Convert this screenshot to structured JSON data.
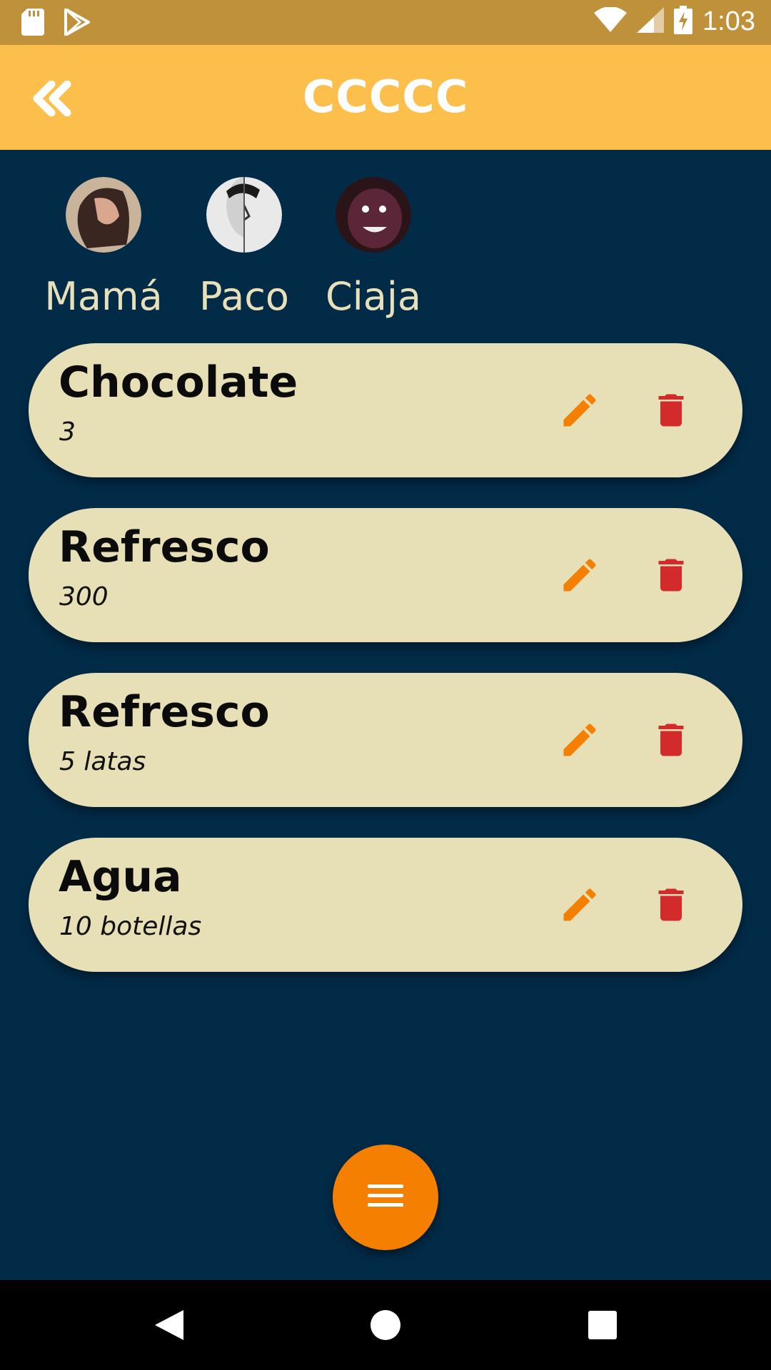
{
  "status_bar": {
    "time": "1:03",
    "icons": [
      "sd-card-icon",
      "play-store-icon",
      "wifi-icon",
      "signal-icon",
      "battery-charging-icon"
    ]
  },
  "app_bar": {
    "title": "CCCCC",
    "back_icon": "double-chevron-left-icon"
  },
  "members": [
    {
      "name": "Mamá"
    },
    {
      "name": "Paco"
    },
    {
      "name": "Ciaja"
    }
  ],
  "items": [
    {
      "title": "Chocolate",
      "detail": "3"
    },
    {
      "title": "Refresco",
      "detail": "300"
    },
    {
      "title": "Refresco",
      "detail": "5 latas"
    },
    {
      "title": "Agua",
      "detail": "10 botellas"
    }
  ],
  "actions": {
    "edit_icon": "pencil-icon",
    "delete_icon": "trash-icon",
    "fab_icon": "menu-icon"
  },
  "colors": {
    "status_bar": "#be913a",
    "app_bar": "#fcbf4b",
    "background": "#022b48",
    "card": "#e7e0b7",
    "edit": "#f57f00",
    "delete": "#d32b2b",
    "fab": "#f57f00",
    "member_name": "#e8e0b9"
  }
}
